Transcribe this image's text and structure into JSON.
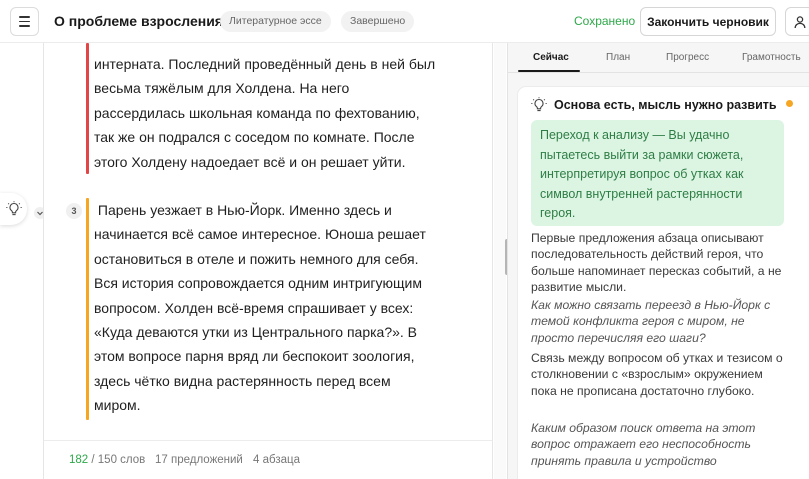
{
  "header": {
    "title": "О проблеме взросления",
    "genre_chip": "Литературное эссе",
    "status_chip": "Завершено",
    "saved_label": "Сохранено",
    "finish_button": "Закончить черновик"
  },
  "editor": {
    "paragraphs": [
      {
        "lines": [
          "интерната. Последний проведённый день в ней был",
          "весьма тяжёлым для Холдена. На него",
          "рассердилась школьная команда по фехтованию,",
          "так же он подрался с соседом по комнате. После",
          "этого Холдену надоедает всё и он решает уйти."
        ],
        "marker_color": "#e24545"
      },
      {
        "number": "3",
        "lines": [
          " Парень уезжает в Нью-Йорк. Именно здесь и",
          "начинается всё самое интересное. Юноша решает",
          "остановиться в отеле и пожить немного для себя.",
          "Вся история сопровождается одним интригующим",
          "вопросом. Холден всё-время спрашивает у всех:",
          "«Куда деваются утки из Центрального парка?». В",
          "этом вопросе парня вряд ли беспокоит зоология,",
          "здесь чётко видна растерянность перед всем",
          "миром."
        ],
        "marker_color": "#f5a623"
      }
    ],
    "footer": {
      "word_count": "182",
      "word_limit": " / 150 слов",
      "sentences": "17 предложений",
      "paragraphs": "4 абзаца"
    }
  },
  "panel": {
    "tabs": [
      "Сейчас",
      "План",
      "Прогресс",
      "Грамотность"
    ],
    "active_tab": "Сейчас",
    "card": {
      "title": "Основа есть, мысль нужно развить",
      "highlight": "Переход к анализу — Вы удачно пытаетесь выйти за рамки сюжета, интерпретируя вопрос об утках как символ внутренней растерянности героя.",
      "text1": "Первые предложения абзаца описывают последовательность действий героя, что больше напоминает пересказ событий, а не развитие мысли.",
      "question1": "Как можно связать переезд в Нью-Йорк с темой конфликта героя с миром, не просто перечисляя его шаги?",
      "text2": "Связь между вопросом об утках и тезисом о столкновении с «взрослым» окружением пока не прописана достаточно глубоко.",
      "question2": "Каким образом поиск ответа на этот вопрос отражает его неспособность принять правила и устройство"
    }
  },
  "colors": {
    "accent_green": "#2ea84a",
    "highlight_bg": "#dcf5e3",
    "highlight_text": "#2e7d45",
    "status_dot": "#f5a623"
  },
  "icons": [
    "menu-icon",
    "lightbulb-icon",
    "chevron-down-icon",
    "user-icon"
  ]
}
